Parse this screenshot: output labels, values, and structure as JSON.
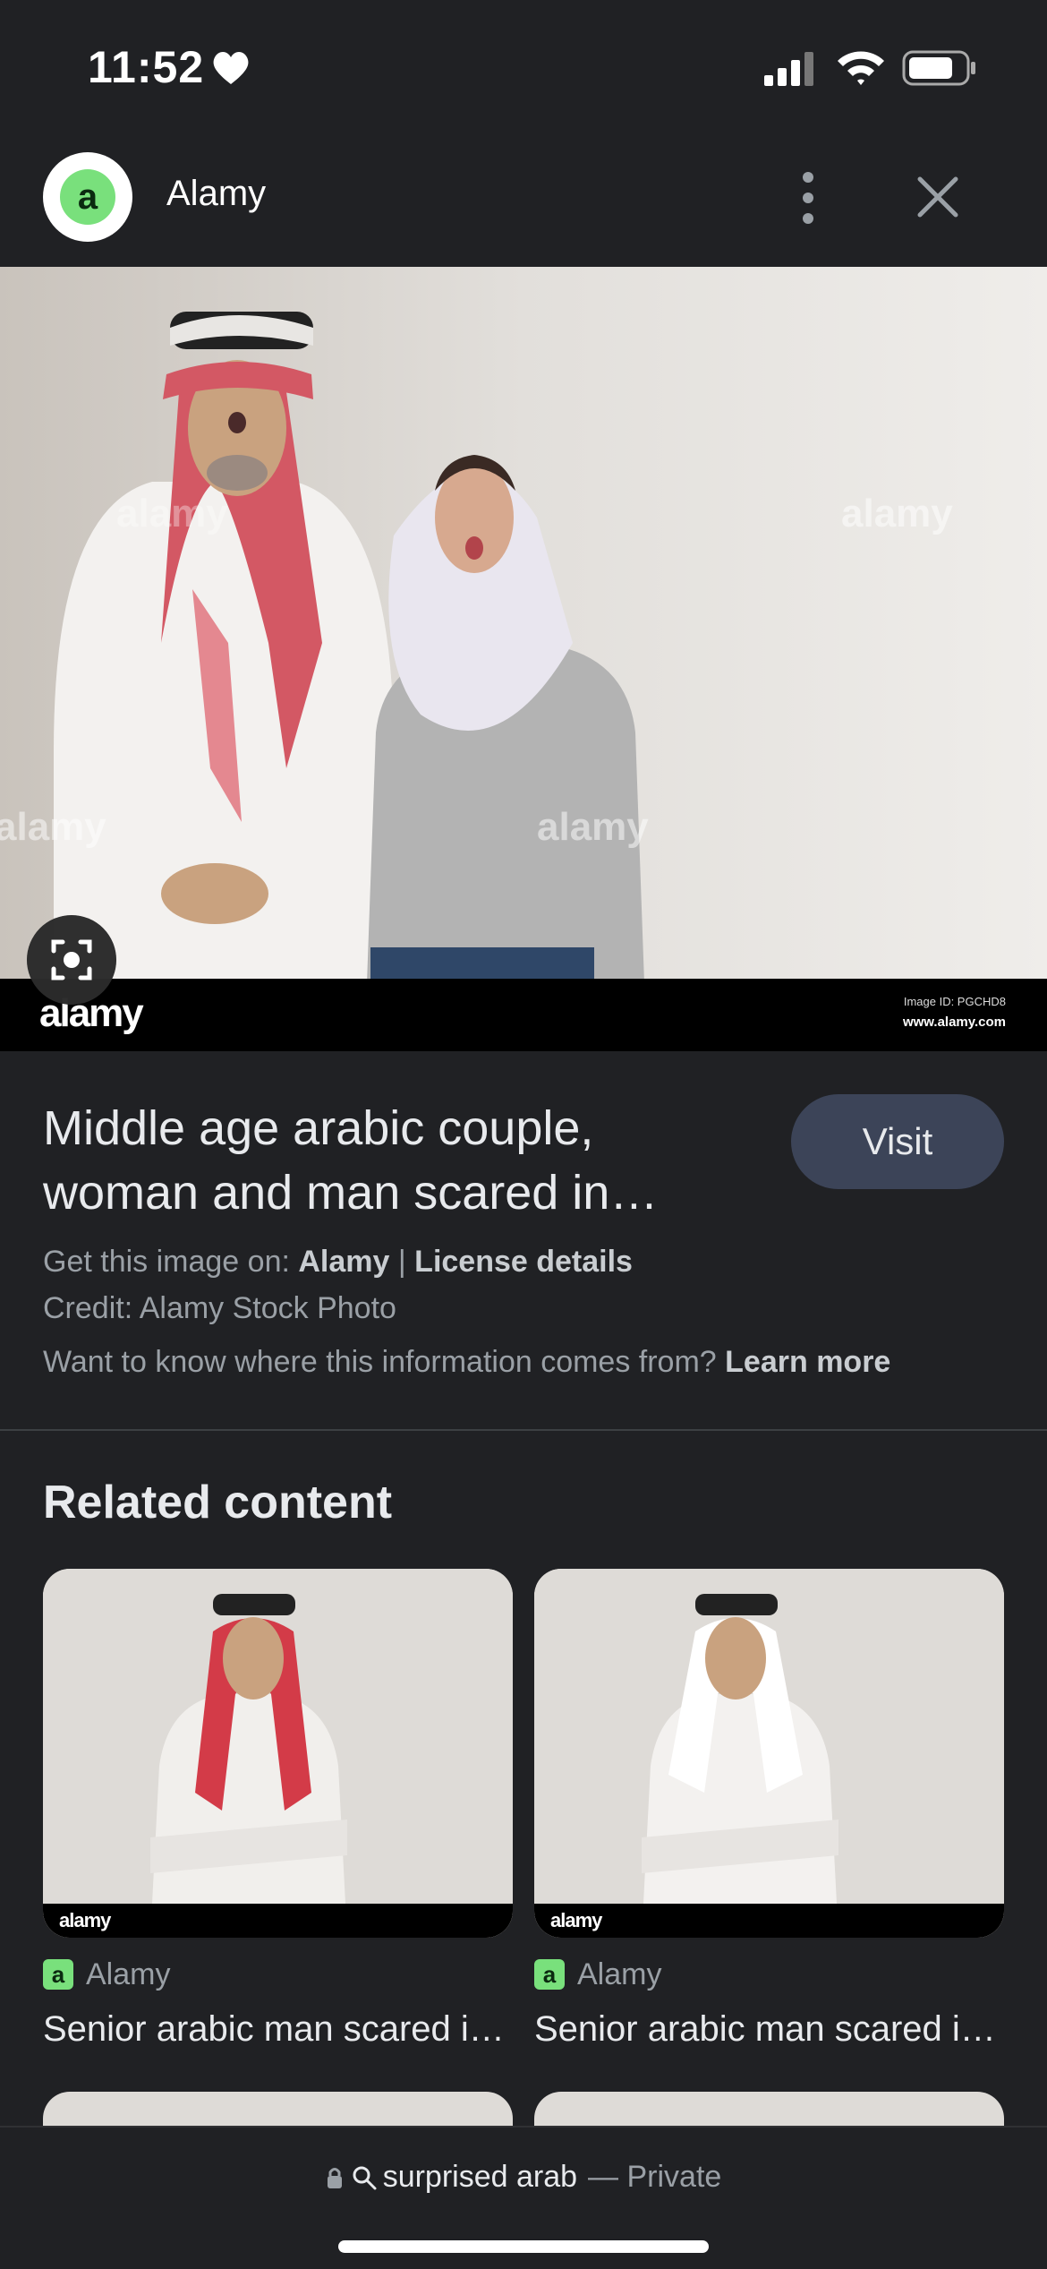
{
  "status": {
    "time": "11:52"
  },
  "site": {
    "name": "Alamy",
    "favicon_letter": "a"
  },
  "hero": {
    "watermark_logo": "alamy",
    "image_id": "Image ID: PGCHD8",
    "url": "www.alamy.com"
  },
  "info": {
    "title": "Middle age arabic couple, woman and man scared in…",
    "visit_label": "Visit",
    "get_prefix": "Get this image on: ",
    "get_source": "Alamy",
    "separator": " | ",
    "license": "License details",
    "credit": "Credit: Alamy Stock Photo",
    "info_question": "Want to know where this information comes from? ",
    "learn_more": "Learn more"
  },
  "related": {
    "title": "Related content",
    "items": [
      {
        "source": "Alamy",
        "caption": "Senior arabic man scared in…",
        "favicon_letter": "a",
        "watermark": "alamy",
        "scarf": "#d33b48"
      },
      {
        "source": "Alamy",
        "caption": "Senior arabic man scared in…",
        "favicon_letter": "a",
        "watermark": "alamy",
        "scarf": "#ffffff"
      }
    ]
  },
  "bottom": {
    "query": "surprised arab",
    "mode": "— Private"
  },
  "colors": {
    "background": "#202124",
    "visit_button": "#3c4458",
    "favicon": "#79e07c"
  }
}
